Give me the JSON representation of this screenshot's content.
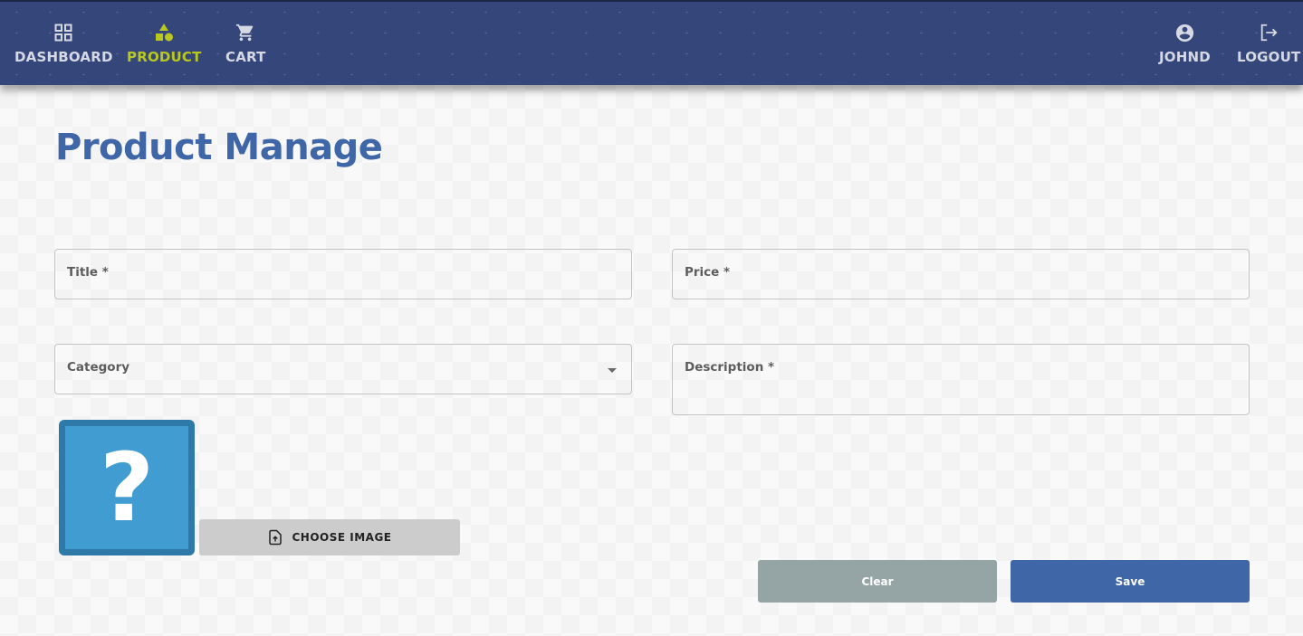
{
  "nav": {
    "dashboard": "DASHBOARD",
    "product": "PRODUCT",
    "cart": "CART",
    "user": "JOHND",
    "logout": "LOGOUT"
  },
  "icons": {
    "dashboard": "grid-icon",
    "product": "shapes-icon",
    "cart": "cart-icon",
    "user": "account-circle-icon",
    "logout": "logout-icon",
    "choose_image": "file-upload-icon",
    "dropdown": "chevron-down-icon"
  },
  "colors": {
    "navbar": "#35467a",
    "active_nav": "#b9c81f",
    "title": "#3f66a7",
    "save": "#3f66a7",
    "clear": "#95a4a5",
    "image_placeholder": "#419dd1"
  },
  "page": {
    "title": "Product Manage"
  },
  "form": {
    "title_label": "Title *",
    "price_label": "Price *",
    "category_label": "Category",
    "description_label": "Description *",
    "image_placeholder": "?",
    "choose_image_label": "CHOOSE IMAGE",
    "clear_label": "Clear",
    "save_label": "Save"
  }
}
